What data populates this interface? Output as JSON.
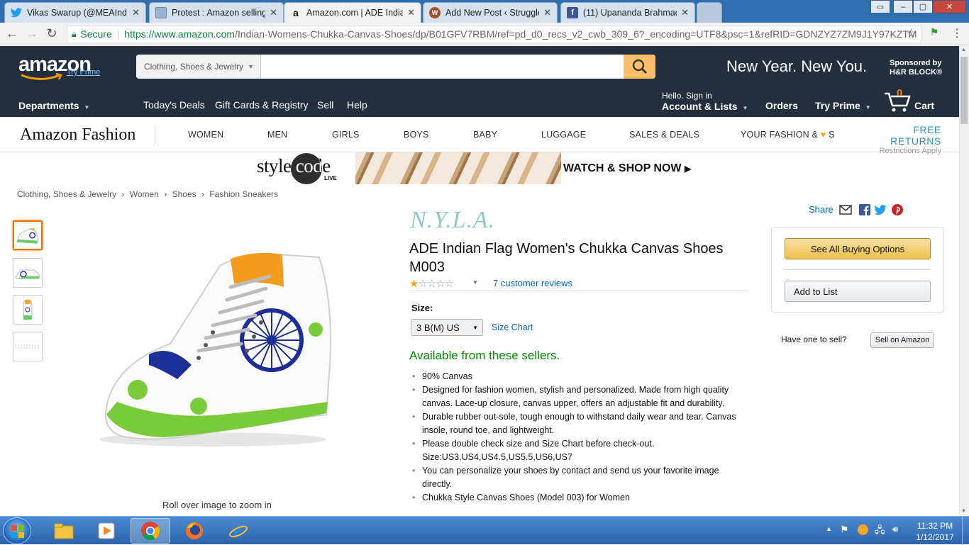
{
  "browser": {
    "tabs": [
      {
        "title": "Vikas Swarup (@MEAInd",
        "favicon": "twitter-icon"
      },
      {
        "title": "Protest : Amazon selling",
        "favicon": "page-icon"
      },
      {
        "title": "Amazon.com | ADE India",
        "favicon": "amazon-icon"
      },
      {
        "title": "Add New Post ‹ Struggle",
        "favicon": "wordpress-icon"
      },
      {
        "title": "(11) Upananda Brahmach",
        "favicon": "facebook-icon"
      }
    ],
    "secure_label": "Secure",
    "url_host": "https://www.amazon.com",
    "url_path": "/Indian-Womens-Chukka-Canvas-Shoes/dp/B01GFV7RBM/ref=pd_d0_recs_v2_cwb_309_6?_encoding=UTF8&psc=1&refRID=GDNZYZ7ZM9J1Y97KZTM"
  },
  "header": {
    "logo": "amazon",
    "try_prime": "Try Prime",
    "search_category": "Clothing, Shoes & Jewelry",
    "search_placeholder": "",
    "promo": "New Year. New You.",
    "sponsor_line1": "Sponsored by",
    "sponsor_line2": "H&R BLOCK®",
    "departments": "Departments",
    "nav": [
      "Today's Deals",
      "Gift Cards & Registry",
      "Sell",
      "Help"
    ],
    "hello": "Hello. Sign in",
    "account": "Account & Lists",
    "orders": "Orders",
    "prime": "Try Prime",
    "cart_count": "0",
    "cart": "Cart"
  },
  "fashion": {
    "logo": "Amazon Fashion",
    "items": [
      "WOMEN",
      "MEN",
      "GIRLS",
      "BOYS",
      "BABY",
      "LUGGAGE",
      "SALES & DEALS"
    ],
    "your_fashion": "YOUR FASHION &",
    "your_fashion_suffix": "S",
    "free_returns": "FREE RETURNS",
    "restrictions": "Restrictions Apply"
  },
  "banner": {
    "brand": "style code",
    "live": "LIVE",
    "cta": "WATCH & SHOP NOW"
  },
  "breadcrumb": [
    "Clothing, Shoes & Jewelry",
    "Women",
    "Shoes",
    "Fashion Sneakers"
  ],
  "product": {
    "brand": "N.Y.L.A.",
    "title": "ADE Indian Flag Women's Chukka Canvas Shoes M003",
    "rating": 1,
    "rating_max": 5,
    "reviews": "7 customer reviews",
    "size_label": "Size:",
    "size_value": "3 B(M) US",
    "size_chart": "Size Chart",
    "availability": "Available from these sellers.",
    "bullets": [
      "90% Canvas",
      "Designed for fashion women, stylish and personalized. Made from high quality canvas. Lace-up closure, canvas upper, offers an adjustable fit and durability.",
      "Durable rubber out-sole, tough enough to withstand daily wear and tear. Canvas insole, round toe, and lightweight.",
      "Please double check size and Size Chart before check-out. Size:US3,US4,US4.5,US5.5,US6,US7",
      "You can personalize your shoes by contact and send us your favorite image directly.",
      "Chukka Style Canvas Shoes (Model 003) for Women"
    ],
    "rollover": "Roll over image to zoom in"
  },
  "sidebar": {
    "share": "Share",
    "see_all": "See All Buying Options",
    "add_to_list": "Add to List",
    "have_one": "Have one to sell?",
    "sell_on": "Sell on Amazon"
  },
  "taskbar": {
    "time": "11:32 PM",
    "date": "1/12/2017"
  },
  "colors": {
    "amazon_nav": "#232f3e",
    "link": "#0066c0",
    "available": "#008a00",
    "search_button": "#febd69",
    "star": "#f4a41d"
  }
}
